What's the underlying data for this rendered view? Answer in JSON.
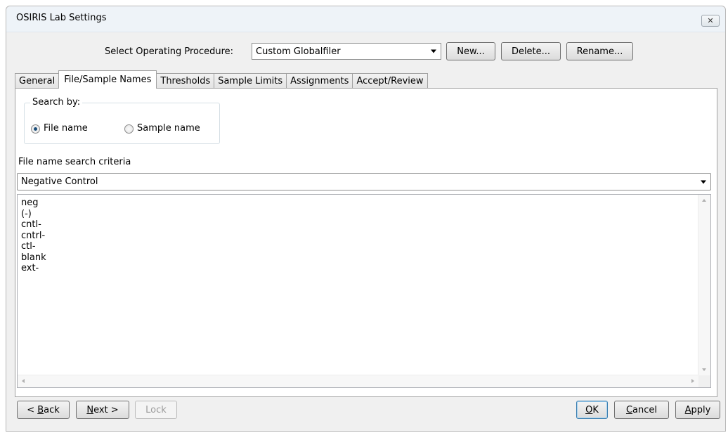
{
  "window": {
    "title": "OSIRIS Lab Settings",
    "close_glyph": "✕"
  },
  "header": {
    "select_label": "Select Operating Procedure:",
    "procedure_value": "Custom Globalfiler",
    "new_label": "New...",
    "delete_label": "Delete...",
    "rename_label": "Rename..."
  },
  "tabs": [
    "General",
    "File/Sample Names",
    "Thresholds",
    "Sample Limits",
    "Assignments",
    "Accept/Review"
  ],
  "active_tab": "File/Sample Names",
  "search_by": {
    "title": "Search by:",
    "options": [
      "File name",
      "Sample name"
    ],
    "selected": "File name"
  },
  "criteria": {
    "label": "File name search criteria",
    "selected": "Negative Control"
  },
  "search_terms": [
    "neg",
    "(-)",
    "cntl-",
    "cntrl-",
    "ctl-",
    "blank",
    "ext-"
  ],
  "footer": {
    "back": {
      "mnemonic": "B",
      "rest": "ack",
      "prefix": "< "
    },
    "next": {
      "mnemonic": "N",
      "rest": "ext >"
    },
    "lock": "Lock",
    "ok": {
      "mnemonic": "O",
      "rest": "K"
    },
    "cancel": {
      "mnemonic": "C",
      "rest": "ancel"
    },
    "apply": {
      "mnemonic": "A",
      "rest": "pply"
    }
  }
}
